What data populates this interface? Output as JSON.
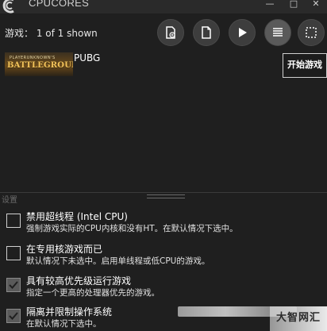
{
  "window": {
    "title": "CPUCORES",
    "minimize": "—",
    "maximize": "□",
    "close": "✕"
  },
  "toolbar": {
    "games_label": "游戏：",
    "games_count": "1 of 1 shown",
    "buttons": [
      {
        "icon": "add-file-icon"
      },
      {
        "icon": "file-icon"
      },
      {
        "icon": "play-icon"
      },
      {
        "icon": "list-icon"
      },
      {
        "icon": "select-icon"
      }
    ]
  },
  "games": [
    {
      "name": "PUBG",
      "thumb_small": "PLAYERUNKNOWN'S",
      "thumb_big": "BATTLEGROUNDS"
    }
  ],
  "start_button": "开始游戏",
  "settings": {
    "section_label": "设置",
    "items": [
      {
        "title": "禁用超线程 (Intel CPU)",
        "desc": "强制游戏实际的CPU内核和没有HT。在默认情况下选中。",
        "checked": false
      },
      {
        "title": "在专用核游戏而已",
        "desc": "默认情况下未选中。启用单线程或低CPU的游戏。",
        "checked": false
      },
      {
        "title": "具有较高优先级运行游戏",
        "desc": "指定一个更高的处理器优先的游戏。",
        "checked": true
      },
      {
        "title": "隔离并限制操作系统",
        "desc": "在默认情况下选中。",
        "checked": true
      }
    ]
  },
  "watermark": "大智网汇"
}
